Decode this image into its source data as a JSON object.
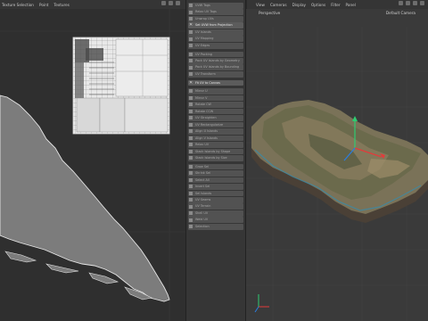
{
  "uv_editor": {
    "menu": [
      "Texture Selection",
      "Point",
      "Textures"
    ]
  },
  "tools": [
    {
      "label": "UVW Tags",
      "state": "normal"
    },
    {
      "label": "Relax UV Tags",
      "state": "normal"
    },
    {
      "label": "Unwrap UVs",
      "state": "normal"
    },
    {
      "label": "Set UVW from Projection",
      "state": "selected",
      "icon": "close-icon"
    },
    {
      "label": "UV Islands",
      "state": "normal"
    },
    {
      "label": "UV Mapping",
      "state": "normal"
    },
    {
      "label": "UV Edges",
      "state": "normal"
    },
    {
      "label": "UV Packing",
      "state": "normal",
      "group_start": true
    },
    {
      "label": "Pack UV Islands by Geometry",
      "state": "normal"
    },
    {
      "label": "Pack UV Islands by Bounding",
      "state": "normal"
    },
    {
      "label": "UV Transform",
      "state": "normal"
    },
    {
      "label": "Fit UV to Canvas",
      "state": "selected",
      "icon": "close-icon",
      "group_start": true
    },
    {
      "label": "Mirror U",
      "state": "normal",
      "group_start": true
    },
    {
      "label": "Mirror V",
      "state": "normal"
    },
    {
      "label": "Rotate CW",
      "state": "normal"
    },
    {
      "label": "Rotate CCW",
      "state": "normal"
    },
    {
      "label": "UV Straighten",
      "state": "normal"
    },
    {
      "label": "UV Rectangularize",
      "state": "normal"
    },
    {
      "label": "Align U Islands",
      "state": "normal"
    },
    {
      "label": "Align V Islands",
      "state": "normal"
    },
    {
      "label": "Relax UV",
      "state": "normal"
    },
    {
      "label": "Stack Islands by Shape",
      "state": "normal"
    },
    {
      "label": "Stack Islands by Size",
      "state": "normal"
    },
    {
      "label": "Grow Sel",
      "state": "normal",
      "group_start": true
    },
    {
      "label": "Shrink Sel",
      "state": "normal"
    },
    {
      "label": "Select All",
      "state": "normal"
    },
    {
      "label": "Invert Sel",
      "state": "normal"
    },
    {
      "label": "Sel Islands",
      "state": "normal"
    },
    {
      "label": "UV Seams",
      "state": "normal"
    },
    {
      "label": "UV Terrain",
      "state": "normal"
    },
    {
      "label": "Shell UV",
      "state": "normal"
    },
    {
      "label": "Weld UV",
      "state": "normal"
    },
    {
      "label": "Selection",
      "state": "normal"
    }
  ],
  "viewport": {
    "menu": [
      "View",
      "Cameras",
      "Display",
      "Options",
      "Filter",
      "Panel"
    ],
    "label": "Perspective",
    "camera": "Default Camera"
  },
  "colors": {
    "accent_axis_x": "#e23b3b",
    "accent_axis_y": "#2ecc71",
    "accent_axis_z": "#2a7de1"
  }
}
